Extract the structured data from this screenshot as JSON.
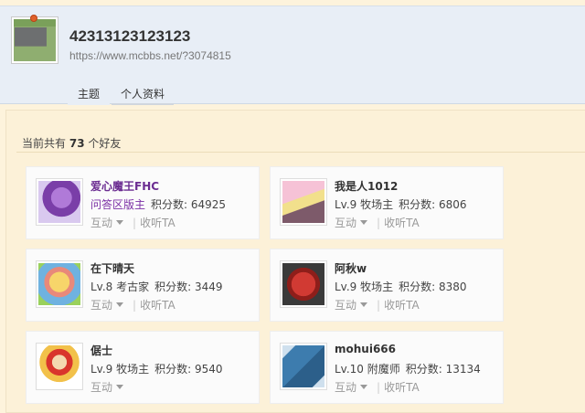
{
  "profile": {
    "username": "42313123123123",
    "url": "https://www.mcbbs.net/?3074815",
    "tabs": [
      "主题",
      "个人资料"
    ]
  },
  "friends_count": {
    "prefix": "当前共有",
    "count": "73",
    "suffix": "个好友"
  },
  "friends": [
    {
      "name": "爱心魔王FHC",
      "level": "问答区版主",
      "score": "积分数: 64925",
      "interact": "互动",
      "listen": "收听TA"
    },
    {
      "name": "我是人1012",
      "level": "Lv.9 牧场主",
      "score": "积分数: 6806",
      "interact": "互动",
      "listen": "收听TA"
    },
    {
      "name": "在下晴天",
      "level": "Lv.8 考古家",
      "score": "积分数: 3449",
      "interact": "互动",
      "listen": "收听TA"
    },
    {
      "name": "阿秋w",
      "level": "Lv.9 牧场主",
      "score": "积分数: 8380",
      "interact": "互动",
      "listen": "收听TA"
    },
    {
      "name": "倨士",
      "level": "Lv.9 牧场主",
      "score": "积分数: 9540",
      "interact": "互动",
      "listen": ""
    },
    {
      "name": "mohui666",
      "level": "Lv.10 附魔师",
      "score": "积分数: 13134",
      "interact": "互动",
      "listen": "收听TA"
    }
  ],
  "colors": {
    "header_bg": "#e8eef6",
    "panel_bg": "#fcf1d8",
    "moderator": "#6b2c91"
  }
}
